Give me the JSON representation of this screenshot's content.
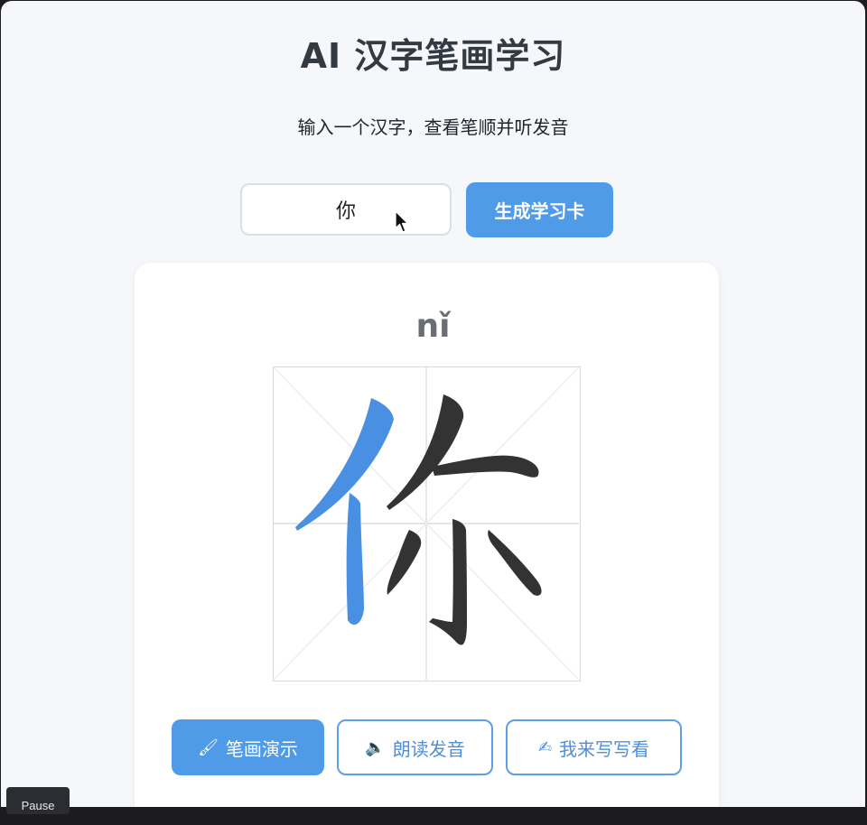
{
  "app": {
    "title": "AI 汉字笔画学习",
    "subtitle": "输入一个汉字，查看笔顺并听发音"
  },
  "search": {
    "value": "你",
    "button_label": "生成学习卡"
  },
  "card": {
    "pinyin": "nǐ",
    "character": "你",
    "active_stroke_color": "#4a90e2",
    "stroke_color": "#333333"
  },
  "actions": {
    "stroke_demo": {
      "icon": "brush-icon",
      "glyph": "🖌",
      "label": "笔画演示"
    },
    "speak": {
      "icon": "speaker-icon",
      "glyph": "🔈",
      "label": "朗读发音"
    },
    "write": {
      "icon": "writing-hand-icon",
      "glyph": "✍",
      "label": "我来写写看"
    }
  },
  "tooltip": {
    "label": "Pause"
  },
  "colors": {
    "accent": "#4f9be8",
    "background": "#f5f7fb"
  }
}
